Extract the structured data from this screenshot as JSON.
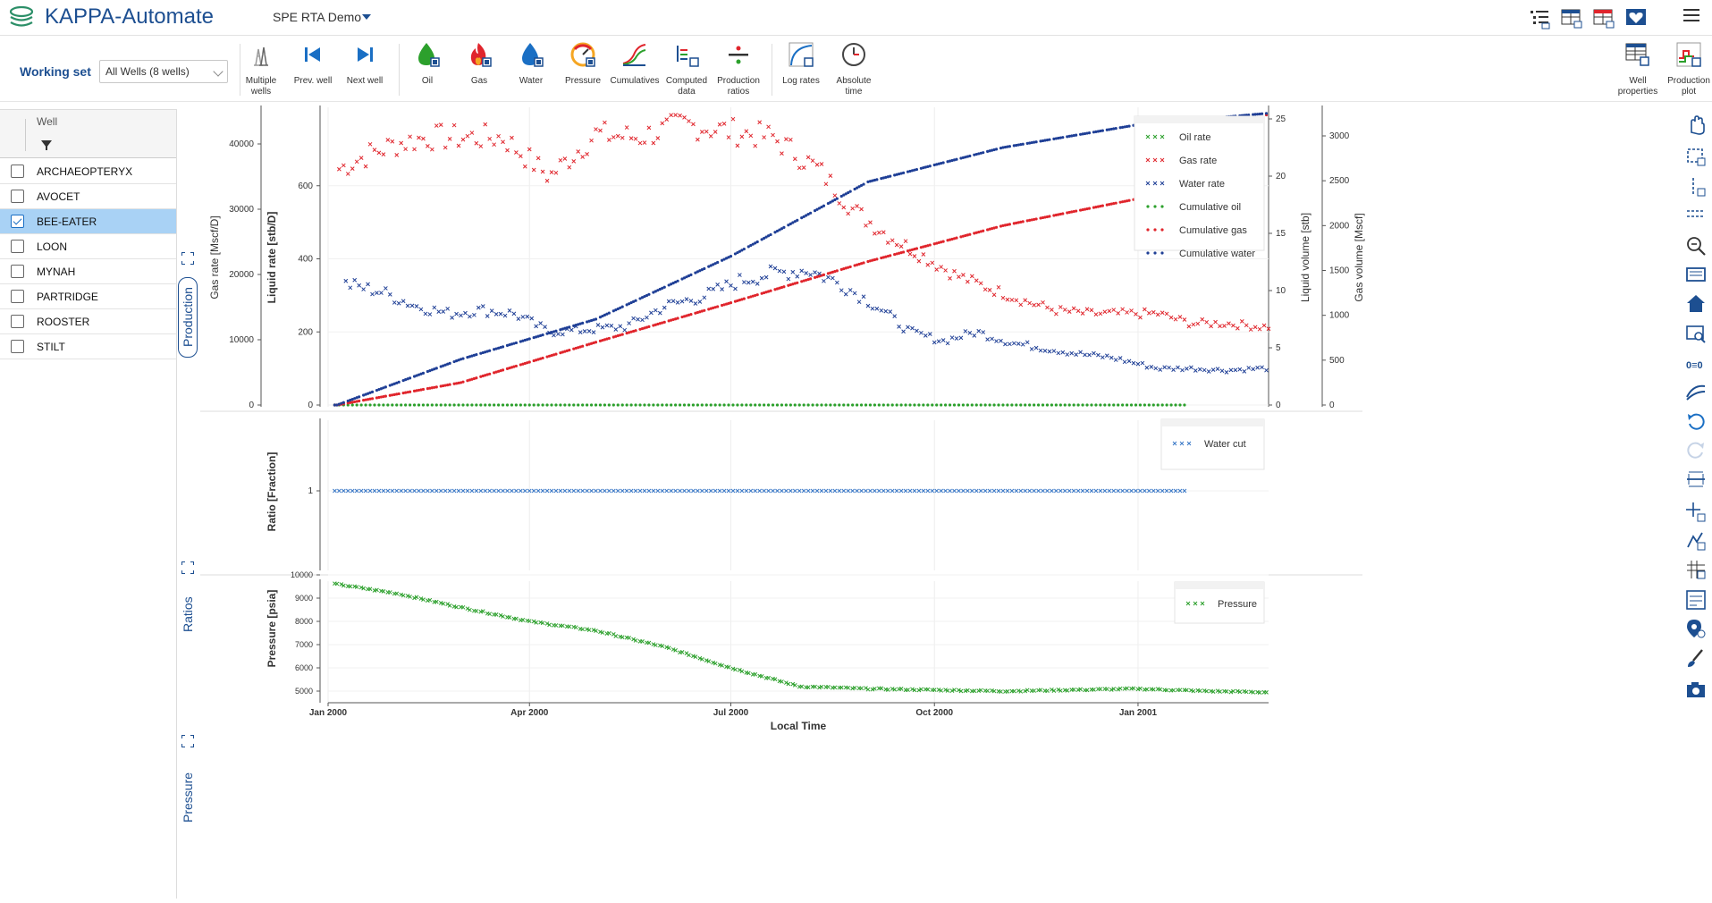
{
  "app": {
    "title": "KAPPA-Automate",
    "project": "SPE RTA Demo"
  },
  "topbar_icons": [
    "tree-list-icon",
    "grid-view-icon",
    "grid-view-2-icon",
    "favorite-icon"
  ],
  "ribbon": {
    "working_set_label": "Working set",
    "working_set_value": "All Wells (8 wells)",
    "buttons": [
      {
        "id": "multiple-wells",
        "label": "Multiple wells"
      },
      {
        "id": "prev-well",
        "label": "Prev. well"
      },
      {
        "id": "next-well",
        "label": "Next well"
      },
      {
        "id": "oil",
        "label": "Oil"
      },
      {
        "id": "gas",
        "label": "Gas"
      },
      {
        "id": "water",
        "label": "Water"
      },
      {
        "id": "pressure",
        "label": "Pressure"
      },
      {
        "id": "cumulatives",
        "label": "Cumulatives"
      },
      {
        "id": "computed-data",
        "label": "Computed data"
      },
      {
        "id": "production-ratios",
        "label": "Production ratios"
      },
      {
        "id": "log-rates",
        "label": "Log rates"
      },
      {
        "id": "absolute-time",
        "label": "Absolute time"
      },
      {
        "id": "well-properties",
        "label": "Well properties"
      },
      {
        "id": "production-plot",
        "label": "Production plot"
      }
    ]
  },
  "wells": {
    "header": "Well",
    "items": [
      {
        "name": "ARCHAEOPTERYX",
        "checked": false
      },
      {
        "name": "AVOCET",
        "checked": false
      },
      {
        "name": "BEE-EATER",
        "checked": true
      },
      {
        "name": "LOON",
        "checked": false
      },
      {
        "name": "MYNAH",
        "checked": false
      },
      {
        "name": "PARTRIDGE",
        "checked": false
      },
      {
        "name": "ROOSTER",
        "checked": false
      },
      {
        "name": "STILT",
        "checked": false
      }
    ]
  },
  "tabs": [
    "Production",
    "Ratios",
    "Pressure"
  ],
  "right_tools": [
    "pan-icon",
    "box-select-icon",
    "vertical-select-icon",
    "horizontal-select-icon",
    "zoom-icon",
    "zoom-extent-icon",
    "home-icon",
    "zoom-rect-icon",
    "axis-zero-icon",
    "smooth-curve-icon",
    "undo-icon",
    "redo-icon",
    "ruler-icon",
    "crosshair-icon",
    "annotation-icon",
    "grid-icon",
    "legend-icon",
    "marker-icon",
    "paint-icon",
    "camera-icon"
  ],
  "chart_data": [
    {
      "type": "scatter",
      "panel": "Production",
      "ylabel": "Liquid rate [stb/D]",
      "ylabel2": "Gas rate [Mscf/D]",
      "ylabel3": "Liquid volume [stb]",
      "ylabel4": "Gas volume [Mscf]",
      "ylim_liquid": [
        0,
        800
      ],
      "yticks_liquid": [
        "0",
        "200",
        "400",
        "600"
      ],
      "yticks_gas": [
        "0",
        "10000",
        "20000",
        "30000",
        "40000"
      ],
      "yticks_liqvol": [
        "0",
        "5",
        "10",
        "15",
        "20",
        "25"
      ],
      "yticks_gasvol": [
        "0",
        "500",
        "1000",
        "1500",
        "2000",
        "2500",
        "3000"
      ],
      "legend": [
        "Oil rate",
        "Gas rate",
        "Water rate",
        "Cumulative oil",
        "Cumulative gas",
        "Cumulative water"
      ],
      "colors": {
        "oil": "#2ca02c",
        "gas": "#e0252c",
        "water": "#1f3f96",
        "cum_oil": "#2ca02c",
        "cum_gas": "#e0252c",
        "cum_water": "#1f3f96"
      },
      "series": [
        {
          "name": "Gas rate",
          "x": [
            "2000-01-05",
            "2000-01-20",
            "2000-02-01",
            "2000-02-15",
            "2000-03-01",
            "2000-03-20",
            "2000-04-10",
            "2000-05-01",
            "2000-05-20",
            "2000-06-10",
            "2000-06-30",
            "2000-07-20",
            "2000-08-10",
            "2000-08-25",
            "2000-09-10",
            "2000-09-25",
            "2000-10-10",
            "2000-10-25",
            "2000-11-10",
            "2000-11-25",
            "2000-12-10",
            "2000-12-25",
            "2001-01-10",
            "2001-01-25",
            "2001-02-10",
            "2001-02-25"
          ],
          "y": [
            36000,
            38500,
            40000,
            41000,
            41000,
            41000,
            35000,
            41500,
            41000,
            43000,
            42000,
            41000,
            36000,
            30000,
            26000,
            23000,
            20000,
            18000,
            16000,
            14500,
            14000,
            14000,
            14000,
            12500,
            12500,
            12000
          ]
        },
        {
          "name": "Water rate",
          "x": [
            "2000-01-10",
            "2000-01-25",
            "2000-02-10",
            "2000-02-25",
            "2000-03-10",
            "2000-03-25",
            "2000-04-10",
            "2000-04-25",
            "2000-05-15",
            "2000-06-01",
            "2000-06-20",
            "2000-07-05",
            "2000-07-20",
            "2000-08-05",
            "2000-08-20",
            "2000-09-05",
            "2000-09-20",
            "2000-10-05",
            "2000-10-20",
            "2000-11-05",
            "2000-11-20",
            "2000-12-05",
            "2000-12-20",
            "2001-01-10",
            "2001-01-25",
            "2001-02-10",
            "2001-02-25"
          ],
          "y": [
            330,
            310,
            270,
            250,
            260,
            250,
            200,
            205,
            215,
            270,
            300,
            340,
            360,
            370,
            330,
            270,
            200,
            175,
            200,
            170,
            155,
            140,
            130,
            100,
            100,
            95,
            100
          ]
        },
        {
          "name": "Oil rate",
          "x": [
            "2000-01-05",
            "2001-01-25"
          ],
          "y": [
            0,
            0
          ]
        },
        {
          "name": "Cumulative gas",
          "x": [
            "2000-01-05",
            "2000-03-01",
            "2000-05-01",
            "2000-07-01",
            "2000-09-01",
            "2000-11-01",
            "2001-01-01",
            "2001-03-01"
          ],
          "y": [
            0,
            250,
            700,
            1140,
            1600,
            2000,
            2300,
            3250
          ]
        },
        {
          "name": "Cumulative water",
          "x": [
            "2000-01-05",
            "2000-03-01",
            "2000-05-01",
            "2000-07-01",
            "2000-09-01",
            "2000-11-01",
            "2001-01-01",
            "2001-03-01"
          ],
          "y": [
            0,
            4,
            7.5,
            13,
            19.5,
            22.5,
            24.5,
            25.5
          ]
        }
      ]
    },
    {
      "type": "scatter",
      "panel": "Ratios",
      "ylabel": "Ratio [Fraction]",
      "yticks": [
        "1"
      ],
      "legend": [
        "Water cut"
      ],
      "series": [
        {
          "name": "Water cut",
          "x": [
            "2000-01-05",
            "2001-01-25"
          ],
          "y": [
            1,
            1
          ]
        }
      ]
    },
    {
      "type": "scatter",
      "panel": "Pressure",
      "ylabel": "Pressure [psia]",
      "yticks": [
        "5000",
        "6000",
        "7000",
        "8000",
        "9000",
        "10000"
      ],
      "ylim": [
        4600,
        10000
      ],
      "legend": [
        "Pressure"
      ],
      "series": [
        {
          "name": "Pressure",
          "x": [
            "2000-01-05",
            "2000-02-01",
            "2000-03-01",
            "2000-04-01",
            "2000-05-01",
            "2000-06-01",
            "2000-07-01",
            "2000-08-01",
            "2000-09-01",
            "2000-10-01",
            "2000-11-01",
            "2000-12-01",
            "2001-01-01",
            "2001-02-01",
            "2001-03-01"
          ],
          "y": [
            9600,
            9200,
            8600,
            8000,
            7600,
            6900,
            6000,
            5200,
            5100,
            5050,
            5000,
            5050,
            5100,
            5000,
            4950
          ]
        }
      ]
    }
  ],
  "x_axis": {
    "label": "Local Time",
    "ticks": [
      "Jan 2000",
      "Apr 2000",
      "Jul 2000",
      "Oct 2000",
      "Jan 2001"
    ]
  }
}
